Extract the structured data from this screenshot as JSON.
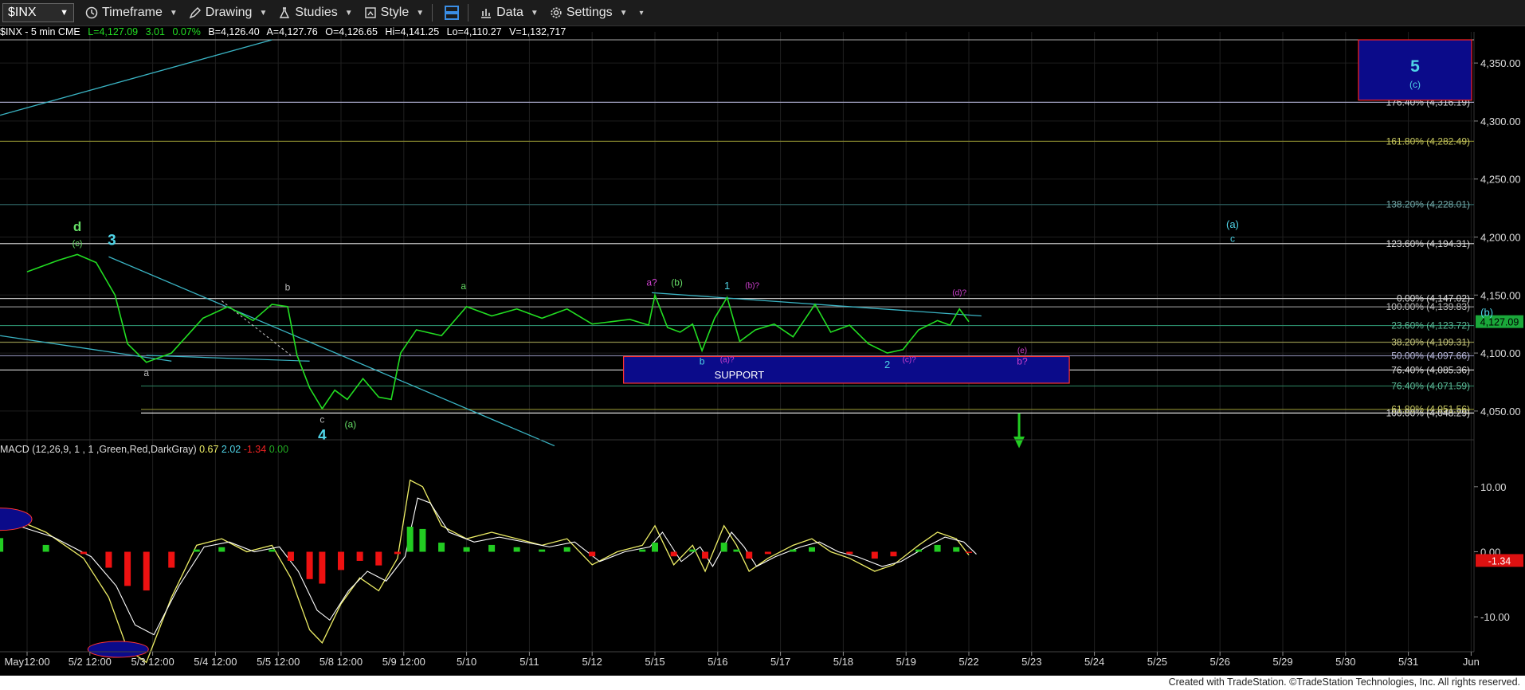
{
  "toolbar": {
    "symbol": "$INX",
    "timeframe": "Timeframe",
    "drawing": "Drawing",
    "studies": "Studies",
    "style": "Style",
    "data": "Data",
    "settings": "Settings"
  },
  "status": {
    "desc": "$INX - 5 min  CME",
    "last": "L=4,127.09",
    "chg": "3.01",
    "pct": "0.07%",
    "bid": "B=4,126.40",
    "ask": "A=4,127.76",
    "open": "O=4,126.65",
    "high": "Hi=4,141.25",
    "low": "Lo=4,110.27",
    "vol": "V=1,132,717"
  },
  "colors": {
    "price": "#22dd22",
    "wave_cyan": "#4fd3e6",
    "wave_magenta": "#d040d0",
    "wave_green": "#66dd66",
    "box": "#0b0b8a",
    "support_border": "#ff3333",
    "macd_pos": "#22cc22",
    "macd_neg": "#ee1111",
    "macd_line": "#eeee66",
    "signal_line": "#ffffff"
  },
  "chart_data": {
    "type": "line",
    "y_axis_labels": [
      "4,350.00",
      "4,300.00",
      "4,250.00",
      "4,200.00",
      "4,150.00",
      "4,100.00",
      "4,050.00"
    ],
    "ylim": [
      4030,
      4370
    ],
    "x_axis_labels": [
      "May12:00",
      "5/2 12:00",
      "5/3 12:00",
      "5/4 12:00",
      "5/5 12:00",
      "5/8 12:00",
      "5/9 12:00",
      "5/10",
      "5/11",
      "5/12",
      "5/15",
      "5/16",
      "5/17",
      "5/18",
      "5/19",
      "5/22",
      "5/23",
      "5/24",
      "5/25",
      "5/26",
      "5/29",
      "5/30",
      "5/31",
      "Jun"
    ],
    "price_series": [
      [
        0,
        4170
      ],
      [
        0.5,
        4180
      ],
      [
        0.8,
        4185
      ],
      [
        1.1,
        4178
      ],
      [
        1.4,
        4150
      ],
      [
        1.6,
        4108
      ],
      [
        1.9,
        4092
      ],
      [
        2.3,
        4100
      ],
      [
        2.8,
        4130
      ],
      [
        3.2,
        4140
      ],
      [
        3.6,
        4128
      ],
      [
        3.9,
        4142
      ],
      [
        4.15,
        4140
      ],
      [
        4.3,
        4098
      ],
      [
        4.5,
        4070
      ],
      [
        4.7,
        4052
      ],
      [
        4.9,
        4068
      ],
      [
        5.1,
        4060
      ],
      [
        5.35,
        4078
      ],
      [
        5.6,
        4062
      ],
      [
        5.8,
        4060
      ],
      [
        5.95,
        4100
      ],
      [
        6.2,
        4120
      ],
      [
        6.6,
        4115
      ],
      [
        7.0,
        4140
      ],
      [
        7.4,
        4132
      ],
      [
        7.8,
        4138
      ],
      [
        8.2,
        4130
      ],
      [
        8.6,
        4138
      ],
      [
        9.0,
        4125
      ],
      [
        9.3,
        4127
      ],
      [
        9.6,
        4129
      ],
      [
        9.9,
        4124
      ],
      [
        10.0,
        4150
      ],
      [
        10.2,
        4122
      ],
      [
        10.4,
        4118
      ],
      [
        10.6,
        4125
      ],
      [
        10.75,
        4102
      ],
      [
        10.95,
        4130
      ],
      [
        11.15,
        4148
      ],
      [
        11.35,
        4110
      ],
      [
        11.6,
        4120
      ],
      [
        11.9,
        4125
      ],
      [
        12.2,
        4114
      ],
      [
        12.4,
        4130
      ],
      [
        12.55,
        4142
      ],
      [
        12.8,
        4118
      ],
      [
        13.1,
        4124
      ],
      [
        13.4,
        4108
      ],
      [
        13.7,
        4100
      ],
      [
        13.95,
        4103
      ],
      [
        14.2,
        4120
      ],
      [
        14.5,
        4128
      ],
      [
        14.7,
        4124
      ],
      [
        14.85,
        4138
      ],
      [
        15.0,
        4127
      ]
    ],
    "fib_levels": [
      {
        "label": "176.40% (4,316.19)",
        "value": 4316.19,
        "color": "#a0a0c0"
      },
      {
        "label": "161.80% (4,282.49)",
        "value": 4282.49,
        "color": "#7a7a2a"
      },
      {
        "label": "138.20% (4,228.01)",
        "value": 4228.01,
        "color": "#2a5a5a"
      },
      {
        "label": "123.60% (4,194.31)",
        "value": 4194.31,
        "color": "#c0c0c0"
      },
      {
        "label": "0.00% (4,147.02)",
        "value": 4147.02,
        "color": "#c0c0c0"
      },
      {
        "label": "100.00% (4,139.83)",
        "value": 4139.83,
        "color": "#888888"
      },
      {
        "label": "23.60% (4,123.72)",
        "value": 4123.72,
        "color": "#2a8a6a"
      },
      {
        "label": "38.20% (4,109.31)",
        "value": 4109.31,
        "color": "#8a8a4a"
      },
      {
        "label": "50.00% (4,097.66)",
        "value": 4097.66,
        "color": "#7a7a9a"
      },
      {
        "label": "76.40% (4,085.36)",
        "value": 4085.36,
        "color": "#c0c0c0"
      },
      {
        "label": "76.40% (4,071.59)",
        "value": 4071.59,
        "color": "#2a7a5a"
      },
      {
        "label": "61.80% (4,051.56)",
        "value": 4051.56,
        "color": "#7a7a2a"
      },
      {
        "label": "100.00% (4,048.29)",
        "value": 4048.29,
        "color": "#e0e0e0"
      }
    ],
    "current_price_label": "4,127.09",
    "support_label": "SUPPORT",
    "target_box": {
      "wave": "5",
      "sub": "(c)"
    },
    "wave_labels": [
      {
        "t": "d",
        "x": 0.8,
        "y": 4205,
        "c": "#66dd66",
        "s": 17
      },
      {
        "t": "(c)",
        "x": 0.8,
        "y": 4192,
        "c": "#66dd66",
        "s": 11
      },
      {
        "t": "3",
        "x": 1.35,
        "y": 4193,
        "c": "#4fd3e6",
        "s": 19
      },
      {
        "t": "b",
        "x": 4.15,
        "y": 4154,
        "c": "#bbbbbb",
        "s": 12
      },
      {
        "t": "a",
        "x": 1.9,
        "y": 4080,
        "c": "#bbbbbb",
        "s": 12
      },
      {
        "t": "c",
        "x": 4.7,
        "y": 4040,
        "c": "#bbbbbb",
        "s": 12
      },
      {
        "t": "4",
        "x": 4.7,
        "y": 4025,
        "c": "#4fd3e6",
        "s": 19
      },
      {
        "t": "(a)",
        "x": 5.15,
        "y": 4036,
        "c": "#66dd66",
        "s": 12
      },
      {
        "t": "a",
        "x": 6.95,
        "y": 4155,
        "c": "#66dd66",
        "s": 12
      },
      {
        "t": "a?",
        "x": 9.95,
        "y": 4158,
        "c": "#d040d0",
        "s": 12
      },
      {
        "t": "(b)",
        "x": 10.35,
        "y": 4158,
        "c": "#66dd66",
        "s": 12
      },
      {
        "t": "1",
        "x": 11.15,
        "y": 4155,
        "c": "#4fd3e6",
        "s": 13
      },
      {
        "t": "(b)?",
        "x": 11.55,
        "y": 4156,
        "c": "#d040d0",
        "s": 10
      },
      {
        "t": "b",
        "x": 10.75,
        "y": 4090,
        "c": "#4fd3e6",
        "s": 12
      },
      {
        "t": "(a)?",
        "x": 11.15,
        "y": 4092,
        "c": "#d040d0",
        "s": 10
      },
      {
        "t": "2",
        "x": 13.7,
        "y": 4087,
        "c": "#4fd3e6",
        "s": 13
      },
      {
        "t": "(c)?",
        "x": 14.05,
        "y": 4092,
        "c": "#d040d0",
        "s": 10
      },
      {
        "t": "(d)?",
        "x": 14.85,
        "y": 4150,
        "c": "#d040d0",
        "s": 10
      },
      {
        "t": "(e)",
        "x": 15.85,
        "y": 4100,
        "c": "#d040d0",
        "s": 10
      },
      {
        "t": "b?",
        "x": 15.85,
        "y": 4090,
        "c": "#d040d0",
        "s": 12
      },
      {
        "t": "(a)",
        "x": 19.2,
        "y": 4208,
        "c": "#4fd3e6",
        "s": 13
      },
      {
        "t": "c",
        "x": 19.2,
        "y": 4196,
        "c": "#4fd3e6",
        "s": 12
      },
      {
        "t": "(b)",
        "x": 23.25,
        "y": 4132,
        "c": "#4fd3e6",
        "s": 13
      }
    ],
    "macd": {
      "label": "MACD (12,26,9, 1 , 1 ,Green,Red,DarkGray)",
      "v1": "0.67",
      "v2": "2.02",
      "v3": "-1.34",
      "v4": "0.00",
      "y_axis_labels": [
        "10.00",
        "0.00",
        "-10.00"
      ],
      "last_label": "-1.34",
      "ylim": [
        -15,
        15
      ]
    }
  },
  "footer": "Created with TradeStation. ©TradeStation Technologies, Inc. All rights reserved."
}
